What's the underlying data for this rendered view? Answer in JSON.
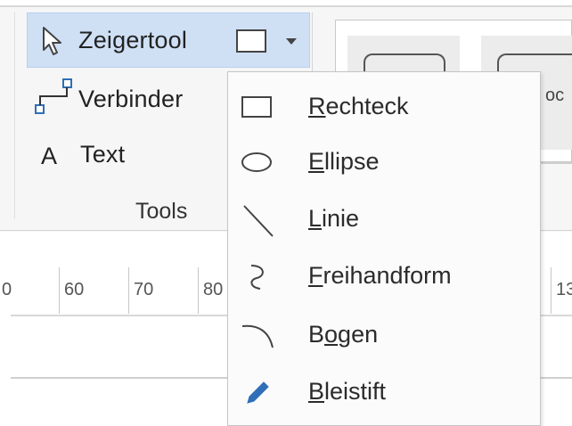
{
  "ribbon": {
    "tools_group_label": "Tools",
    "pointer_tool_label": "Zeigertool",
    "connector_label": "Verbinder",
    "text_tool_icon": "A",
    "text_tool_label": "Text",
    "gallery_fragment": "oc"
  },
  "ruler": {
    "ticks": [
      "0",
      "60",
      "70",
      "80",
      "13"
    ]
  },
  "shape_menu": {
    "items": [
      {
        "label": "Rechteck",
        "accel": "R",
        "rest": "echteck",
        "icon": "rectangle-icon"
      },
      {
        "label": "Ellipse",
        "accel": "E",
        "rest": "llipse",
        "icon": "ellipse-icon"
      },
      {
        "label": "Linie",
        "accel": "L",
        "rest": "inie",
        "icon": "line-icon"
      },
      {
        "label": "Freihandform",
        "accel": "F",
        "rest": "reihandform",
        "icon": "freeform-icon"
      },
      {
        "label": "Bogen",
        "pre": "B",
        "accel": "o",
        "rest": "gen",
        "icon": "arc-icon"
      },
      {
        "label": "Bleistift",
        "accel": "B",
        "rest": "leistift",
        "icon": "pencil-icon"
      }
    ]
  },
  "colors": {
    "selection_fill": "#cfe0f5",
    "pencil_blue": "#2e6fb7"
  }
}
